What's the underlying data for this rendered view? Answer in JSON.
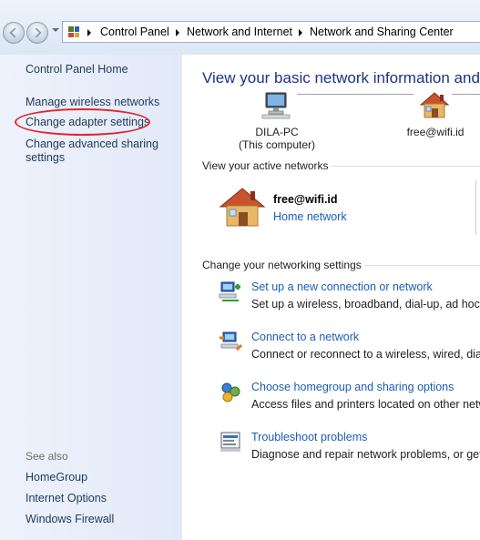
{
  "breadcrumb": [
    "Control Panel",
    "Network and Internet",
    "Network and Sharing Center"
  ],
  "left_pane": {
    "home": "Control Panel Home",
    "links": [
      "Manage wireless networks",
      "Change adapter settings",
      "Change advanced sharing",
      "settings"
    ],
    "see_also_label": "See also",
    "see_also": [
      "HomeGroup",
      "Internet Options",
      "Windows Firewall"
    ]
  },
  "main": {
    "title": "View your basic network information and se",
    "computer_name": "DILA-PC",
    "computer_sub": "(This computer)",
    "network_node": "free@wifi.id",
    "active_networks_label": "View your active networks",
    "active_network": {
      "name": "free@wifi.id",
      "type": "Home network"
    },
    "settings_label": "Change your networking settings",
    "tasks": [
      {
        "title": "Set up a new connection or network",
        "desc": "Set up a wireless, broadband, dial-up, ad hoc, or"
      },
      {
        "title": "Connect to a network",
        "desc": "Connect or reconnect to a wireless, wired, dial-u"
      },
      {
        "title": "Choose homegroup and sharing options",
        "desc": "Access files and printers located on other netwo"
      },
      {
        "title": "Troubleshoot problems",
        "desc": "Diagnose and repair network problems, or get tr"
      }
    ]
  },
  "colors": {
    "link": "#1c5cb8",
    "title": "#1e3287",
    "highlight": "#e0262c"
  }
}
